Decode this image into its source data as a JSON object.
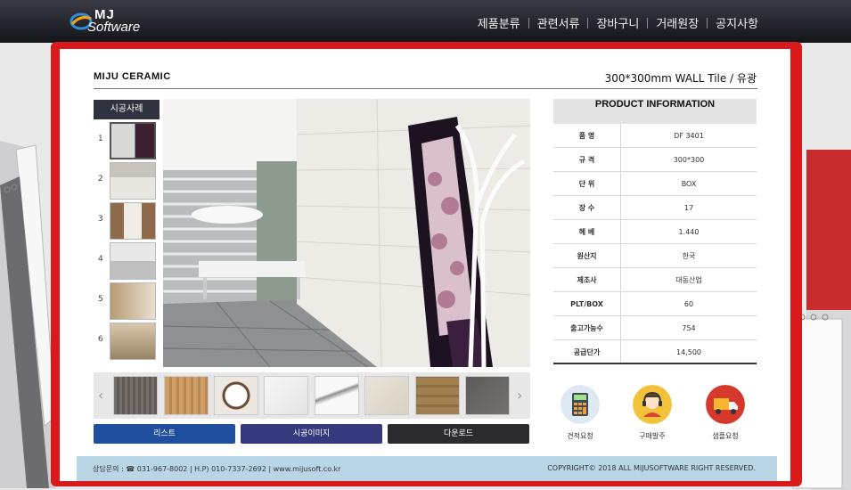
{
  "brand": {
    "mark": "MJ",
    "name": "Software"
  },
  "nav": [
    "제품분류",
    "관련서류",
    "장바구니",
    "거래원장",
    "공지사항"
  ],
  "product": {
    "name": "MIJU CERAMIC",
    "spec": "300*300mm   WALL Tile / 유광"
  },
  "gallery": {
    "label": "시공사례",
    "thumbs": [
      "1",
      "2",
      "3",
      "4",
      "5",
      "6"
    ],
    "active_index": 1
  },
  "swatches": {
    "prev_arrow": "‹",
    "next_arrow": "›",
    "colors": [
      "#6f6a66",
      "#c99a63",
      "#ece8e1",
      "#f1f1f1",
      "#f5f5f5",
      "#e3ded4",
      "#9b7c4d",
      "#5d5b59"
    ]
  },
  "buttons": [
    {
      "label": "리스트",
      "color": "#1f4f9e"
    },
    {
      "label": "시공이미지",
      "color": "#343a7d"
    },
    {
      "label": "다운로드",
      "color": "#2b2b30"
    }
  ],
  "info": {
    "heading": "PRODUCT INFORMATION",
    "rows": [
      {
        "key": "품 명",
        "value": "DF 3401"
      },
      {
        "key": "규 격",
        "value": "300*300"
      },
      {
        "key": "단 위",
        "value": "BOX"
      },
      {
        "key": "장 수",
        "value": "17"
      },
      {
        "key": "헤 베",
        "value": "1.440"
      },
      {
        "key": "원산지",
        "value": "한국"
      },
      {
        "key": "제조사",
        "value": "대동산업"
      },
      {
        "key": "PLT/BOX",
        "value": "60"
      },
      {
        "key": "출고가능수",
        "value": "754"
      },
      {
        "key": "공급단가",
        "value": "14,500"
      }
    ]
  },
  "actions": [
    {
      "label": "견적요청",
      "icon": "calculator-icon",
      "color": "#dfe9f2"
    },
    {
      "label": "구매발주",
      "icon": "headset-agent-icon",
      "color": "#f2c23a"
    },
    {
      "label": "샘플요청",
      "icon": "delivery-truck-icon",
      "color": "#d6382b"
    }
  ],
  "footer": {
    "contact": "상담문의 : ☎ 031-967-8002 | H.P) 010-7337-2692 | www.mijusoft.co.kr",
    "copyright": "COPYRIGHT© 2018 ALL MIJUSOFTWARE RIGHT RESERVED."
  }
}
